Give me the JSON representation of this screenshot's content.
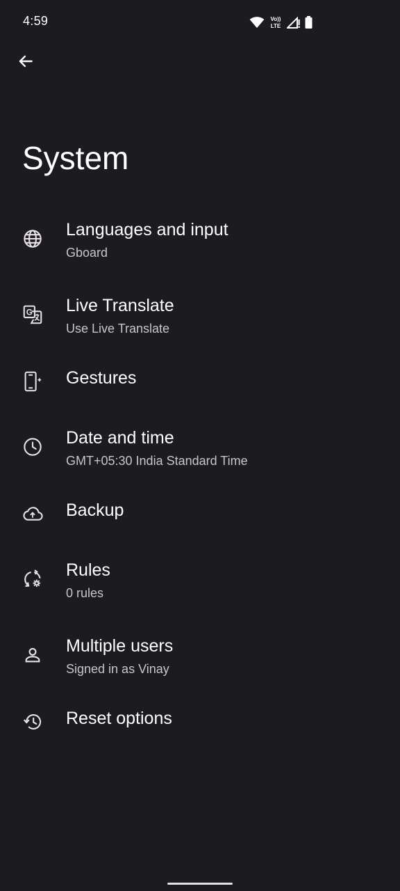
{
  "status_bar": {
    "time": "4:59",
    "network_label": "VoLTE",
    "icons": [
      "wifi-icon",
      "volte-icon",
      "signal-icon",
      "battery-icon"
    ]
  },
  "header": {
    "back_icon": "arrow-back-icon",
    "title": "System"
  },
  "settings": {
    "items": [
      {
        "icon": "globe-icon",
        "title": "Languages and input",
        "subtitle": "Gboard"
      },
      {
        "icon": "translate-icon",
        "title": "Live Translate",
        "subtitle": "Use Live Translate"
      },
      {
        "icon": "gestures-icon",
        "title": "Gestures"
      },
      {
        "icon": "clock-icon",
        "title": "Date and time",
        "subtitle": "GMT+05:30 India Standard Time"
      },
      {
        "icon": "cloud-upload-icon",
        "title": "Backup"
      },
      {
        "icon": "rules-icon",
        "title": "Rules",
        "subtitle": "0 rules"
      },
      {
        "icon": "person-icon",
        "title": "Multiple users",
        "subtitle": "Signed in as Vinay"
      },
      {
        "icon": "history-icon",
        "title": "Reset options"
      }
    ]
  },
  "colors": {
    "background": "#1c1b20",
    "text_primary": "#ffffff",
    "text_secondary": "#c9c5ca",
    "icon": "#e6e1e5"
  }
}
